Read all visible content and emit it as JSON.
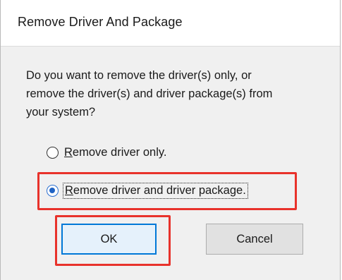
{
  "window": {
    "title": "Remove Driver And Package"
  },
  "message": {
    "line1": "Do you want to remove the driver(s) only, or",
    "line2": "remove the driver(s) and driver package(s) from",
    "line3": "your system?"
  },
  "options": [
    {
      "accel": "R",
      "rest": "emove driver only.",
      "selected": false
    },
    {
      "accel": "R",
      "rest": "emove driver and driver package.",
      "selected": true
    }
  ],
  "buttons": {
    "ok_label": "OK",
    "cancel_label": "Cancel"
  },
  "colors": {
    "highlight": "#e8322b",
    "accent": "#0078d7"
  }
}
